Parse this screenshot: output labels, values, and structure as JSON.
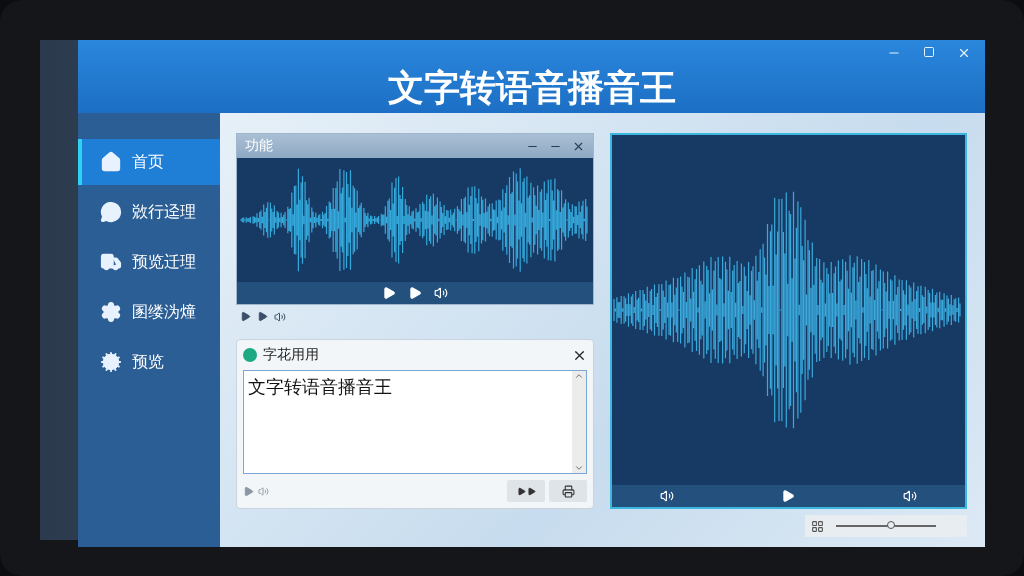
{
  "window": {
    "title": "文字转语音播音王"
  },
  "sidebar": {
    "items": [
      {
        "label": "首页",
        "selected": true
      },
      {
        "label": "敚行迳理",
        "selected": false
      },
      {
        "label": "预览迁理",
        "selected": false
      },
      {
        "label": "圂缕沩燑",
        "selected": false
      },
      {
        "label": "预览",
        "selected": false
      }
    ]
  },
  "wave_panel": {
    "title": "功能"
  },
  "text_panel": {
    "title": "字花用用",
    "value": "文字转语音播音王"
  },
  "status_bar": {
    "zoom": {
      "level": 0.55
    }
  }
}
